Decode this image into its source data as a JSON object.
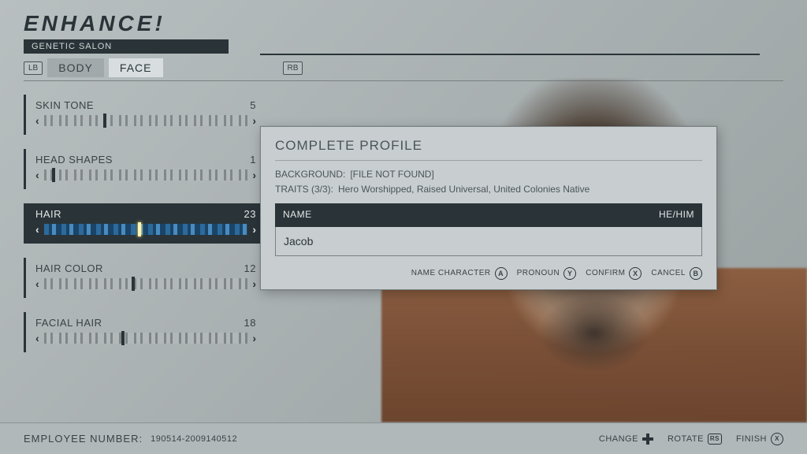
{
  "header": {
    "title": "ENHANCE!",
    "subtitle": "GENETIC SALON"
  },
  "bumpers": {
    "left": "LB",
    "right": "RB"
  },
  "tabs": [
    {
      "label": "BODY",
      "active": false
    },
    {
      "label": "FACE",
      "active": true
    }
  ],
  "sliders": [
    {
      "label": "SKIN TONE",
      "value": "5",
      "pos": 29,
      "selected": false
    },
    {
      "label": "HEAD SHAPES",
      "value": "1",
      "pos": 4,
      "selected": false
    },
    {
      "label": "HAIR",
      "value": "23",
      "pos": 46,
      "selected": true
    },
    {
      "label": "HAIR COLOR",
      "value": "12",
      "pos": 43,
      "selected": false
    },
    {
      "label": "FACIAL HAIR",
      "value": "18",
      "pos": 38,
      "selected": false
    }
  ],
  "modal": {
    "title": "COMPLETE PROFILE",
    "background_label": "BACKGROUND:",
    "background_value": "[FILE NOT FOUND]",
    "traits_label": "TRAITS (3/3):",
    "traits_value": "Hero Worshipped, Raised Universal, United Colonies Native",
    "name_label": "NAME",
    "pronoun": "HE/HIM",
    "name_value": "Jacob",
    "actions": [
      {
        "label": "NAME CHARACTER",
        "glyph": "A"
      },
      {
        "label": "PRONOUN",
        "glyph": "Y"
      },
      {
        "label": "CONFIRM",
        "glyph": "X"
      },
      {
        "label": "CANCEL",
        "glyph": "B"
      }
    ]
  },
  "footer": {
    "label": "EMPLOYEE NUMBER:",
    "value": "190514-2009140512",
    "actions": [
      {
        "label": "CHANGE",
        "glyph": "dpad"
      },
      {
        "label": "ROTATE",
        "glyph": "RS"
      },
      {
        "label": "FINISH",
        "glyph": "X"
      }
    ]
  }
}
